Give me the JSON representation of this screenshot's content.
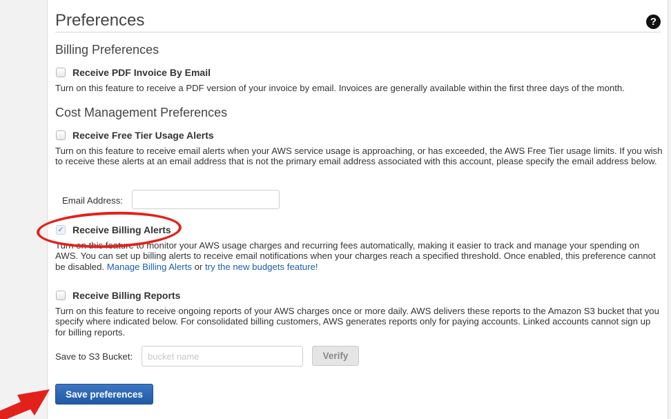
{
  "page": {
    "title": "Preferences",
    "help_icon": "question-circle-icon"
  },
  "billing": {
    "heading": "Billing Preferences",
    "pdf_invoice": {
      "label": "Receive PDF Invoice By Email",
      "checked": false,
      "description": "Turn on this feature to receive a PDF version of your invoice by email. Invoices are generally available within the first three days of the month."
    }
  },
  "cost": {
    "heading": "Cost Management Preferences",
    "free_tier": {
      "label": "Receive Free Tier Usage Alerts",
      "checked": false,
      "description": "Turn on this feature to receive email alerts when your AWS service usage is approaching, or has exceeded, the AWS Free Tier usage limits. If you wish to receive these alerts at an email address that is not the primary email address associated with this account, please specify the email address below."
    },
    "email": {
      "label": "Email Address:",
      "value": ""
    },
    "billing_alerts": {
      "label": "Receive Billing Alerts",
      "checked": true,
      "description_text": "Turn on this feature to monitor your AWS usage charges and recurring fees automatically, making it easier to track and manage your spending on AWS. You can set up billing alerts to receive email notifications when your charges reach a specified threshold. Once enabled, this preference cannot be disabled. ",
      "link_manage": "Manage Billing Alerts",
      "connector": " or ",
      "link_budgets": "try the new budgets feature!"
    },
    "billing_reports": {
      "label": "Receive Billing Reports",
      "checked": false,
      "description": "Turn on this feature to receive ongoing reports of your AWS charges once or more daily. AWS delivers these reports to the Amazon S3 bucket that you specify where indicated below. For consolidated billing customers, AWS generates reports only for paying accounts. Linked accounts cannot sign up for billing reports."
    },
    "s3": {
      "label": "Save to S3 Bucket:",
      "placeholder": "bucket name",
      "verify_label": "Verify"
    }
  },
  "actions": {
    "save_label": "Save preferences"
  },
  "annotations": {
    "highlight_color": "#e3211b",
    "arrow_color": "#e3211b"
  }
}
